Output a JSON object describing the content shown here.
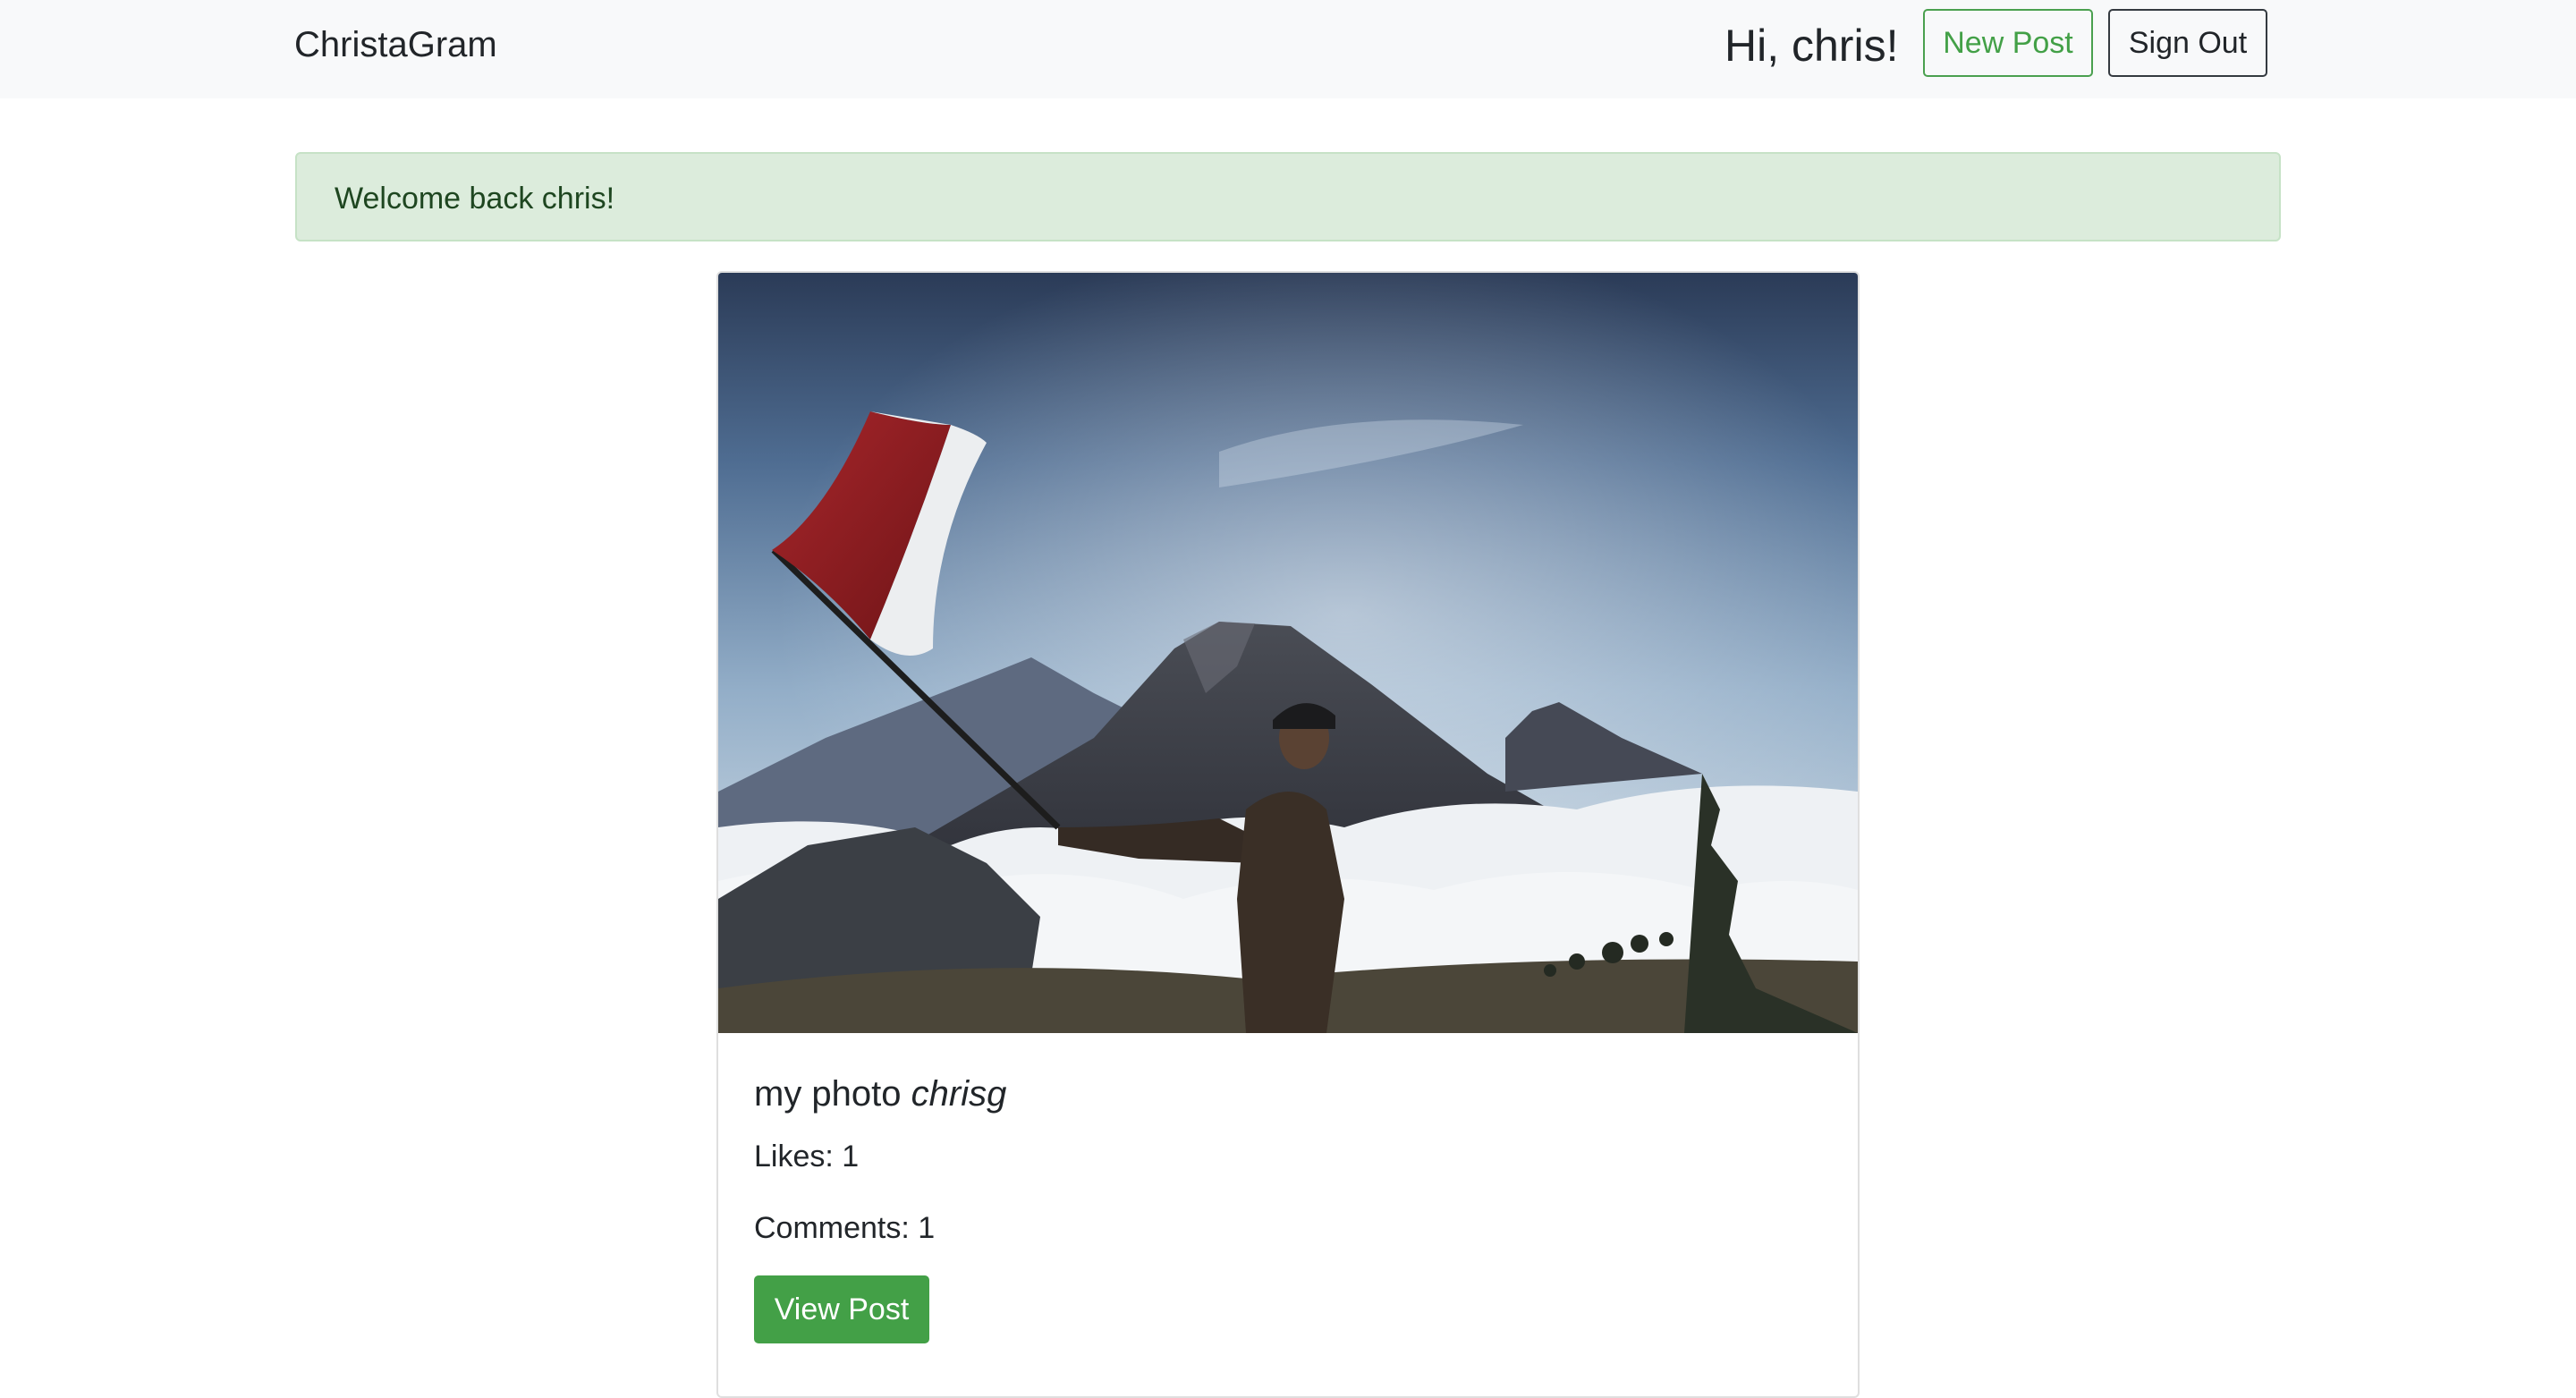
{
  "navbar": {
    "brand": "ChristaGram",
    "greeting": "Hi, chris!",
    "new_post_label": "New Post",
    "sign_out_label": "Sign Out"
  },
  "alert": {
    "message": "Welcome back chris!"
  },
  "post": {
    "image_alt": "Person holding a red and white flag on a mountain summit above the clouds with a volcano in the background",
    "title": "my photo",
    "author": "chrisg",
    "likes_text": "Likes: 1",
    "comments_text": "Comments: 1",
    "likes": 1,
    "comments": 1,
    "view_post_label": "View Post"
  },
  "colors": {
    "success": "#43a047",
    "navbar_bg": "#f8f9fa",
    "alert_bg": "#dcecdc",
    "alert_text": "#1e4620"
  }
}
